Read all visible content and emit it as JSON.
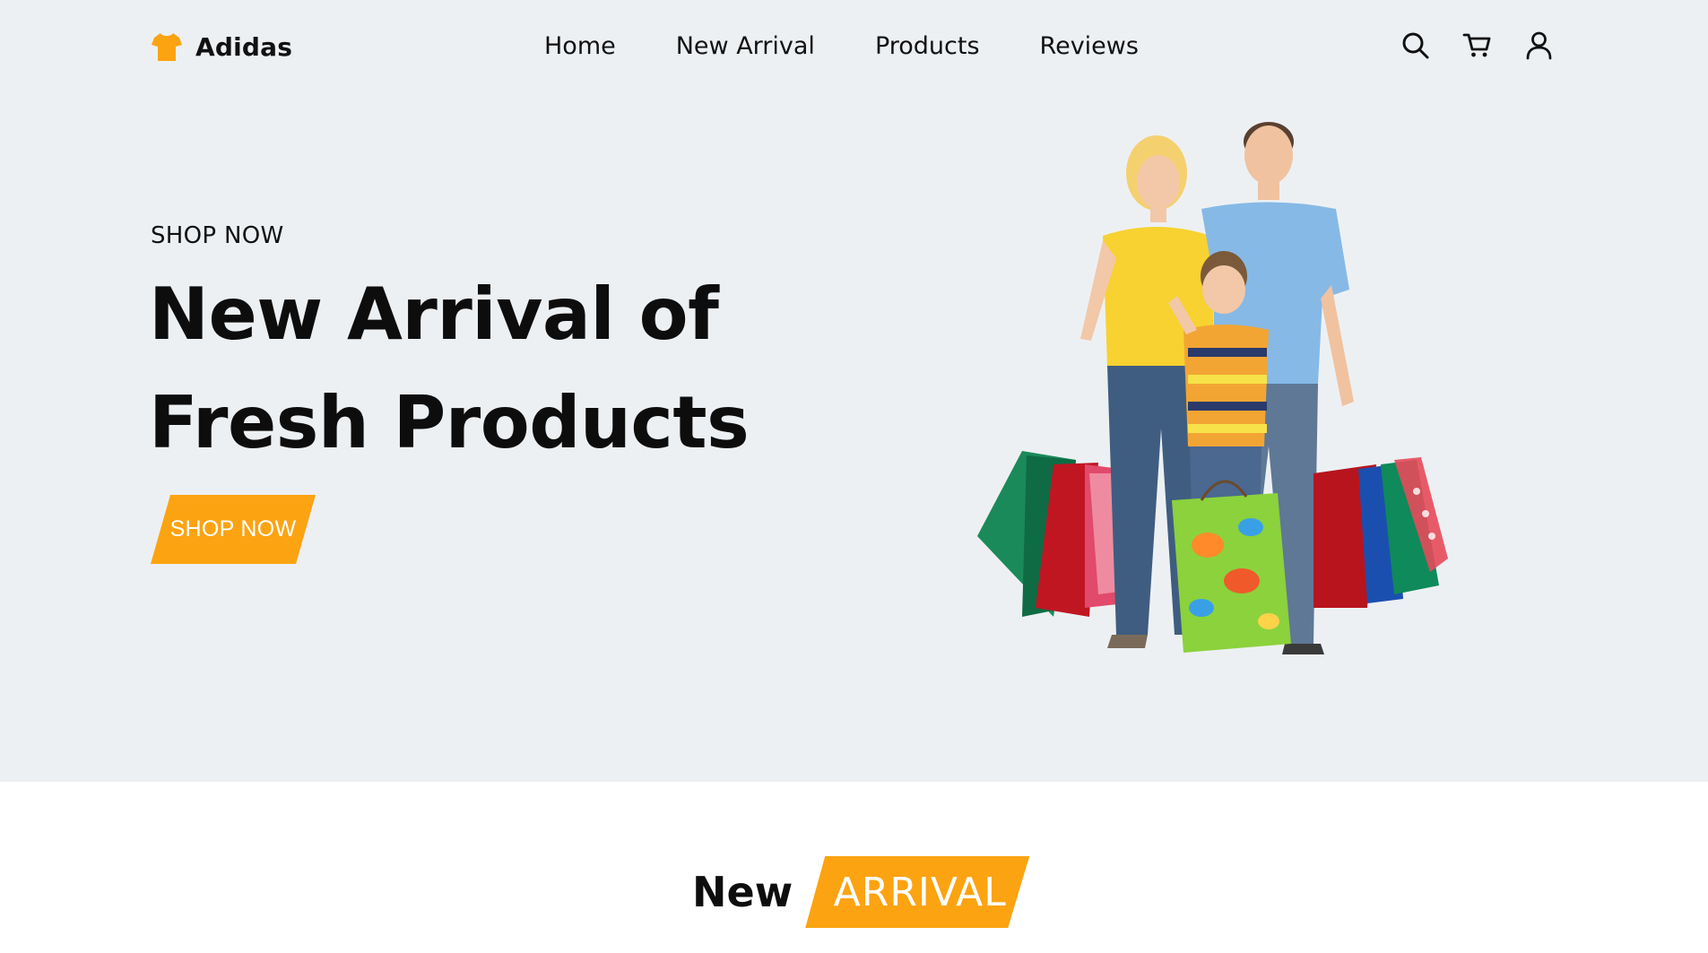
{
  "brand": {
    "name": "Adidas",
    "logo_icon": "tshirt-icon",
    "accent_color": "#fca311"
  },
  "nav": {
    "links": [
      {
        "label": "Home"
      },
      {
        "label": "New Arrival"
      },
      {
        "label": "Products"
      },
      {
        "label": "Reviews"
      }
    ],
    "icons": [
      "search-icon",
      "cart-icon",
      "user-icon"
    ]
  },
  "hero": {
    "eyebrow": "SHOP NOW",
    "title_line1": "New Arrival of",
    "title_line2": "Fresh Products",
    "cta_label": "SHOP NOW",
    "background_color": "#edf0f3",
    "image_description_icon": "family-shopping-illustration"
  },
  "new_arrival_section": {
    "word": "New",
    "badge": "ARRIVAL"
  }
}
